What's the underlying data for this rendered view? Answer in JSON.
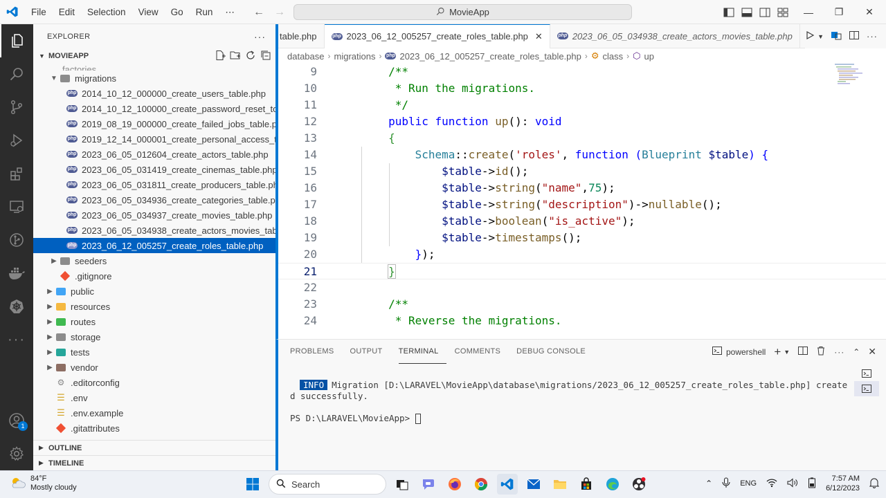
{
  "titlebar": {
    "menu": [
      "File",
      "Edit",
      "Selection",
      "View",
      "Go",
      "Run",
      "⋯"
    ],
    "search_text": "MovieApp"
  },
  "sidebar": {
    "header": "EXPLORER",
    "project": "MOVIEAPP",
    "folded_item": "factories",
    "migrations_folder": "migrations",
    "files": [
      "2014_10_12_000000_create_users_table.php",
      "2014_10_12_100000_create_password_reset_to...",
      "2019_08_19_000000_create_failed_jobs_table.p...",
      "2019_12_14_000001_create_personal_access_to...",
      "2023_06_05_012604_create_actors_table.php",
      "2023_06_05_031419_create_cinemas_table.php",
      "2023_06_05_031811_create_producers_table.php",
      "2023_06_05_034936_create_categories_table.php",
      "2023_06_05_034937_create_movies_table.php",
      "2023_06_05_034938_create_actors_movies_tabl...",
      "2023_06_12_005257_create_roles_table.php"
    ],
    "folders": [
      "seeders",
      "public",
      "resources",
      "routes",
      "storage",
      "tests",
      "vendor"
    ],
    "root_files": [
      ".gitignore",
      ".editorconfig",
      ".env",
      ".env.example",
      ".gitattributes"
    ],
    "outline": "OUTLINE",
    "timeline": "TIMELINE"
  },
  "tabs": [
    {
      "label": "table.php"
    },
    {
      "label": "2023_06_12_005257_create_roles_table.php"
    },
    {
      "label": "2023_06_05_034938_create_actors_movies_table.php"
    }
  ],
  "breadcrumb": [
    "database",
    "migrations",
    "2023_06_12_005257_create_roles_table.php",
    "class",
    "up"
  ],
  "code": {
    "line_numbers": [
      "9",
      "10",
      "11",
      "12",
      "13",
      "14",
      "15",
      "16",
      "17",
      "18",
      "19",
      "20",
      "21",
      "22",
      "23",
      "24"
    ],
    "current_line": "21"
  },
  "panel": {
    "tabs": [
      "PROBLEMS",
      "OUTPUT",
      "TERMINAL",
      "COMMENTS",
      "DEBUG CONSOLE"
    ],
    "shell": "powershell",
    "info_tag": "INFO",
    "msg_line1": "Migration [D:\\LARAVEL\\MovieApp\\database\\migrations/2023_06_12_005257_create_roles_table.php] create",
    "msg_line2": "d successfully.",
    "prompt": "PS D:\\LARAVEL\\MovieApp> "
  },
  "taskbar": {
    "temperature": "84°F",
    "weather": "Mostly cloudy",
    "search": "Search",
    "lang": "ENG",
    "time": "7:57 AM",
    "date": "6/12/2023"
  },
  "badges": {
    "accounts": "1"
  },
  "colors": {
    "accent": "#0078d4",
    "selection": "#0060c0",
    "activity_bar": "#2c2c2c"
  }
}
